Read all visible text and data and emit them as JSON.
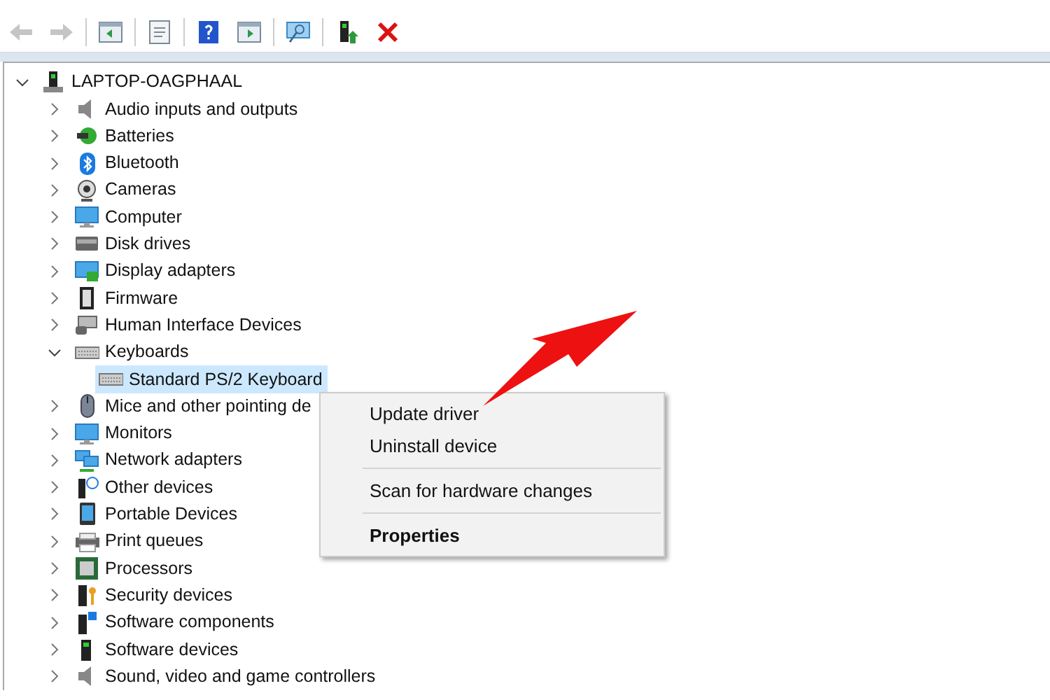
{
  "toolbar": [
    {
      "disabled": true
    },
    {
      "disabled": true
    },
    {
      "disabled": false
    },
    {
      "disabled": false
    },
    {
      "disabled": false
    },
    {
      "disabled": false
    },
    {
      "disabled": false
    },
    {
      "disabled": false
    },
    {
      "disabled": false
    }
  ],
  "tree": {
    "label": "LAPTOP-OAGPHAAL",
    "expanded": true,
    "children": [
      {
        "label": "Audio inputs and outputs",
        "expanded": false
      },
      {
        "label": "Batteries",
        "expanded": false
      },
      {
        "label": "Bluetooth",
        "expanded": false
      },
      {
        "label": "Cameras",
        "expanded": false
      },
      {
        "label": "Computer",
        "expanded": false
      },
      {
        "label": "Disk drives",
        "expanded": false
      },
      {
        "label": "Display adapters",
        "expanded": false
      },
      {
        "label": "Firmware",
        "expanded": false
      },
      {
        "label": "Human Interface Devices",
        "expanded": false
      },
      {
        "label": "Keyboards",
        "expanded": true,
        "children": [
          {
            "label": "Standard PS/2 Keyboard",
            "selected": true
          }
        ]
      },
      {
        "label": "Mice and other pointing de",
        "expanded": false
      },
      {
        "label": "Monitors",
        "expanded": false
      },
      {
        "label": "Network adapters",
        "expanded": false
      },
      {
        "label": "Other devices",
        "expanded": false
      },
      {
        "label": "Portable Devices",
        "expanded": false
      },
      {
        "label": "Print queues",
        "expanded": false
      },
      {
        "label": "Processors",
        "expanded": false
      },
      {
        "label": "Security devices",
        "expanded": false
      },
      {
        "label": "Software components",
        "expanded": false
      },
      {
        "label": "Software devices",
        "expanded": false
      },
      {
        "label": "Sound, video and game controllers",
        "expanded": false
      }
    ]
  },
  "context_menu": [
    {
      "kind": "item",
      "label": "Update driver",
      "default": false
    },
    {
      "kind": "item",
      "label": "Uninstall device",
      "default": false
    },
    {
      "kind": "separator"
    },
    {
      "kind": "item",
      "label": "Scan for hardware changes",
      "default": false
    },
    {
      "kind": "separator"
    },
    {
      "kind": "item",
      "label": "Properties",
      "default": true
    }
  ]
}
